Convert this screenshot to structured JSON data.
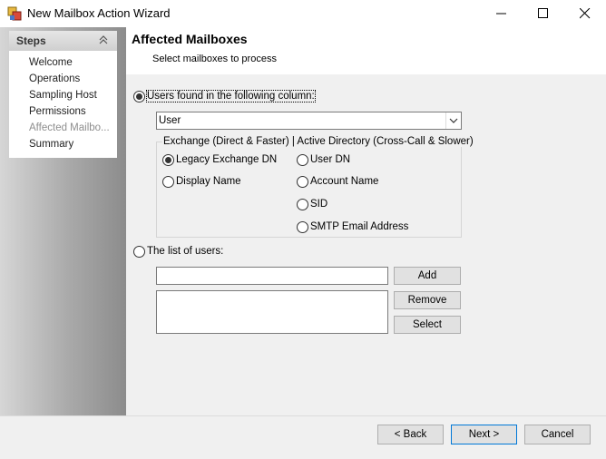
{
  "window": {
    "title": "New Mailbox Action Wizard",
    "icon": "mailbox-app-icon",
    "controls": [
      "minimize-icon",
      "maximize-icon",
      "close-icon"
    ]
  },
  "steps": {
    "header": "Steps",
    "items": [
      {
        "label": "Welcome"
      },
      {
        "label": "Operations"
      },
      {
        "label": "Sampling Host"
      },
      {
        "label": "Permissions"
      },
      {
        "label": "Affected Mailbo..."
      },
      {
        "label": "Summary"
      }
    ],
    "current_index": 4
  },
  "page": {
    "title": "Affected Mailboxes",
    "subtitle": "Select mailboxes to process"
  },
  "source_column": {
    "radio_label": "Users found in the following column:",
    "selected": true,
    "combo_value": "User"
  },
  "group": {
    "title": "Exchange (Direct & Faster) | Active Directory (Cross-Call & Slower)",
    "exchange_options": [
      {
        "label": "Legacy Exchange DN",
        "checked": true
      },
      {
        "label": "Display Name",
        "checked": false
      }
    ],
    "ad_options": [
      {
        "label": "User DN",
        "checked": false
      },
      {
        "label": "Account Name",
        "checked": false
      },
      {
        "label": "SID",
        "checked": false
      },
      {
        "label": "SMTP Email Address",
        "checked": false
      }
    ]
  },
  "user_list": {
    "radio_label": "The list of users:",
    "selected": false,
    "input_value": "",
    "add_label": "Add",
    "remove_label": "Remove",
    "select_label": "Select"
  },
  "footer": {
    "back_label": "< Back",
    "next_label": "Next >",
    "cancel_label": "Cancel"
  },
  "colors": {
    "accent": "#0078d7",
    "steps_current": "#8e8e8e"
  }
}
